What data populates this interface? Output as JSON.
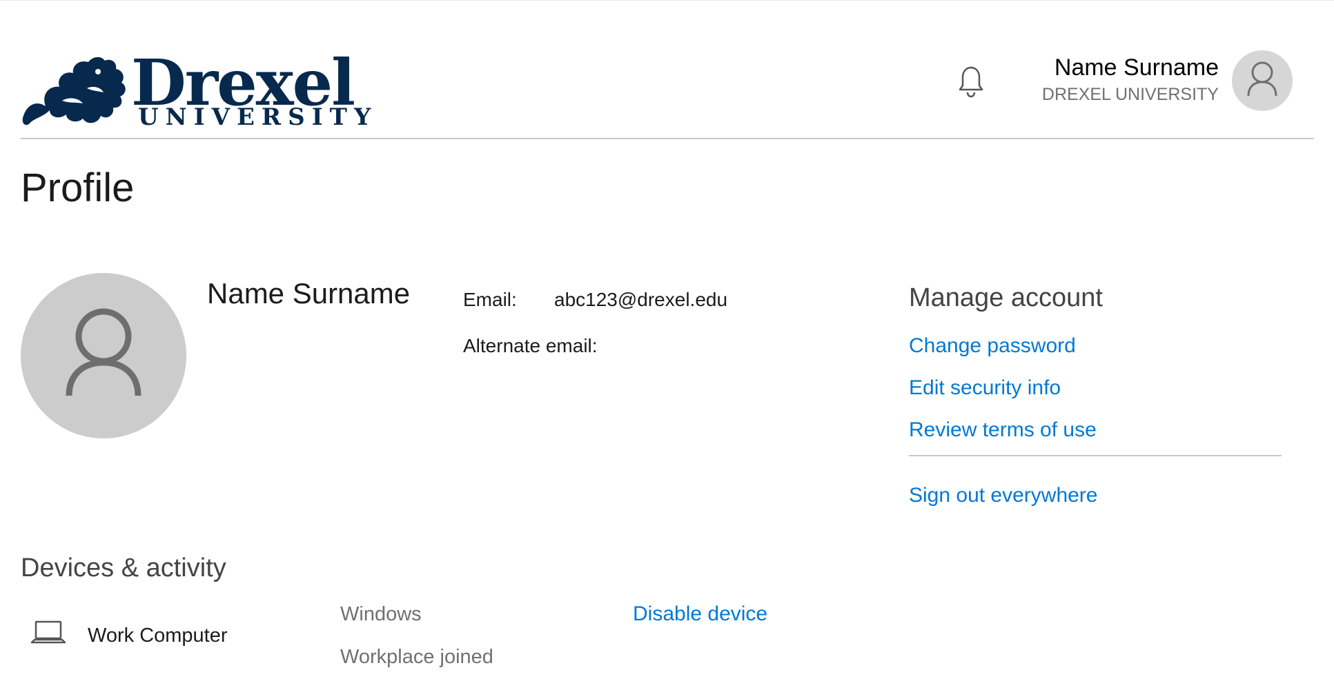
{
  "header": {
    "logo": {
      "wordmark": "Drexel",
      "subtitle": "UNIVERSITY",
      "icon": "dragon-logo"
    },
    "notifications_icon": "bell-icon",
    "user": {
      "name": "Name Surname",
      "organization": "DREXEL UNIVERSITY",
      "avatar_icon": "person-icon"
    }
  },
  "page": {
    "title": "Profile"
  },
  "profile": {
    "avatar_icon": "person-icon",
    "name": "Name Surname",
    "fields": {
      "email_label": "Email:",
      "email_value": "abc123@drexel.edu",
      "alternate_email_label": "Alternate email:"
    }
  },
  "manage_account": {
    "title": "Manage account",
    "links": {
      "change_password": "Change password",
      "edit_security_info": "Edit security info",
      "review_terms": "Review terms of use",
      "sign_out_everywhere": "Sign out everywhere"
    }
  },
  "devices": {
    "title": "Devices & activity",
    "items": [
      {
        "icon": "laptop-icon",
        "name": "Work Computer",
        "os": "Windows",
        "join_type": "Workplace joined",
        "action": "Disable device"
      }
    ]
  },
  "colors": {
    "brand_navy": "#07294d",
    "link_blue": "#0078d4",
    "avatar_gray": "#cccccc"
  }
}
